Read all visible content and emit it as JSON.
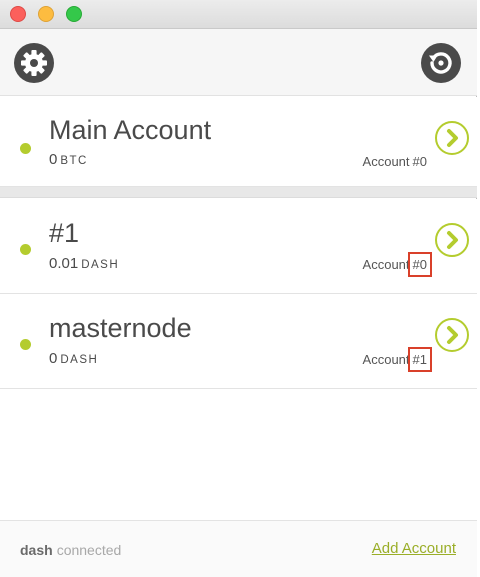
{
  "window": {
    "accent_color": "#b4cc2e",
    "highlight_color": "#d9402a"
  },
  "toolbar": {
    "settings_icon": "gear-icon",
    "refresh_icon": "refresh-icon"
  },
  "accounts": [
    {
      "name": "Main Account",
      "balance": "0",
      "unit": "BTC",
      "label": "Account",
      "number": "#0",
      "status": "connected",
      "open_icon": "chevron-right-icon"
    },
    {
      "name": "#1",
      "balance": "0.01",
      "unit": "DASH",
      "label": "Account",
      "number": "#0",
      "status": "connected",
      "open_icon": "chevron-right-icon"
    },
    {
      "name": "masternode",
      "balance": "0",
      "unit": "DASH",
      "label": "Account",
      "number": "#1",
      "status": "connected",
      "open_icon": "chevron-right-icon"
    }
  ],
  "footer": {
    "network": "dash",
    "status": "connected",
    "add_account_label": "Add Account"
  }
}
